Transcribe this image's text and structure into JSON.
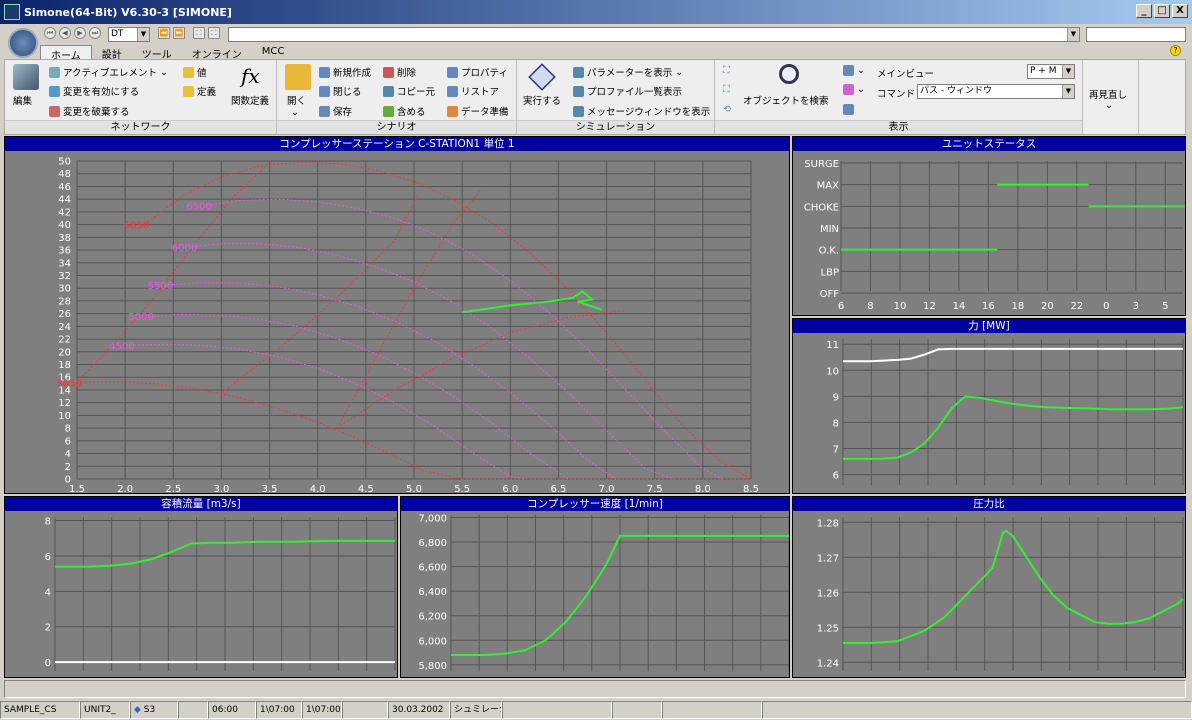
{
  "window": {
    "title": "Simone(64-Bit) V6.30-3 [SIMONE]",
    "min": "_",
    "max": "□",
    "close": "X"
  },
  "nav": {
    "mode_value": "DT"
  },
  "tabs": [
    "ホーム",
    "設計",
    "ツール",
    "オンライン",
    "MCC"
  ],
  "ribbon": {
    "network": {
      "label": "ネットワーク",
      "edit": "編集",
      "active_element": "アクティブエレメント",
      "enable_changes": "変更を有効にする",
      "discard_changes": "変更を破棄する",
      "value": "値",
      "definition": "定義",
      "fx": "fx",
      "function_def": "関数定義"
    },
    "scenario": {
      "label": "シナリオ",
      "open": "開く",
      "new": "新規作成",
      "close": "閉じる",
      "save": "保存",
      "delete": "削除",
      "copy_from": "コピー元",
      "include": "含める",
      "properties": "プロパティ",
      "restore": "リストア",
      "data_prep": "データ準備"
    },
    "simulation": {
      "label": "シミュレーション",
      "run": "実行する",
      "show_params": "パラメーターを表示",
      "profile_list": "プロファイル一覧表示",
      "message_window": "メッセージウィンドウを表示"
    },
    "display": {
      "label": "表示",
      "search_object": "オブジェクトを検索",
      "main_view_label": "メインビュー",
      "main_view_value": "P + M",
      "command_label": "コマンド",
      "command_value": "パス - ウィンドウ"
    },
    "review": {
      "label": "再見直し"
    }
  },
  "panels": {
    "map": "コンプレッサーステーション C-STATION1 単位 1",
    "status": "ユニットステータス",
    "power": "力 [MW]",
    "flow": "容積流量 [m3/s]",
    "speed": "コンプレッサー速度 [1/min]",
    "ratio": "圧力比"
  },
  "chart_data": [
    {
      "type": "line",
      "title": "コンプレッサーステーション C-STATION1 単位 1",
      "xlim": [
        1.5,
        8.5
      ],
      "ylim": [
        0,
        50
      ],
      "x_ticks": [
        "1.5",
        "2.0",
        "2.5",
        "3.0",
        "3.5",
        "4.0",
        "4.5",
        "5.0",
        "5.5",
        "6.0",
        "6.5",
        "7.0",
        "7.5",
        "8.0",
        "8.5"
      ],
      "y_ticks": [
        "0",
        "2",
        "4",
        "6",
        "8",
        "10",
        "12",
        "14",
        "16",
        "18",
        "20",
        "22",
        "24",
        "26",
        "28",
        "30",
        "32",
        "34",
        "36",
        "38",
        "40",
        "42",
        "44",
        "46",
        "48",
        "50"
      ],
      "speed_labels": [
        "6850",
        "6500",
        "6000",
        "5500",
        "5000",
        "4500",
        "3850"
      ],
      "speed_lines": [
        {
          "name": "6850",
          "x": [
            2.2,
            2.6,
            3.0,
            3.4,
            3.8,
            4.2,
            4.6,
            5.0,
            5.4,
            5.8,
            6.2,
            6.6,
            7.0,
            7.4,
            7.8,
            8.2,
            8.5
          ],
          "y": [
            40,
            44.5,
            47.5,
            49.2,
            49.8,
            49.6,
            48.6,
            46.8,
            44.0,
            40.4,
            35.6,
            29.8,
            23.0,
            15.6,
            8.2,
            2.6,
            0
          ],
          "color": "#ff3030"
        },
        {
          "name": "6500",
          "x": [
            2.85,
            3.2,
            3.6,
            4.0,
            4.4,
            4.8,
            5.2,
            5.6,
            6.0,
            6.4,
            6.8,
            7.2,
            7.6,
            8.0,
            8.2
          ],
          "y": [
            43,
            43.8,
            44,
            43.6,
            42.6,
            41.0,
            38.6,
            35.4,
            31.2,
            26.2,
            20.4,
            14,
            7.6,
            1.6,
            0
          ],
          "color": "#ee55ee"
        },
        {
          "name": "6000",
          "x": [
            2.7,
            3.0,
            3.4,
            3.8,
            4.2,
            4.6,
            5.0,
            5.4,
            5.8,
            6.2,
            6.6,
            7.0,
            7.4,
            7.7
          ],
          "y": [
            36.5,
            37.0,
            37.0,
            36.4,
            35.2,
            33.4,
            31.0,
            27.8,
            23.8,
            19.0,
            13.6,
            7.6,
            1.6,
            0
          ],
          "color": "#ee55ee"
        },
        {
          "name": "5500",
          "x": [
            2.45,
            2.8,
            3.2,
            3.6,
            4.0,
            4.4,
            4.8,
            5.2,
            5.6,
            6.0,
            6.4,
            6.8,
            7.1
          ],
          "y": [
            30.5,
            30.9,
            30.8,
            30.2,
            29.0,
            27.2,
            24.8,
            21.8,
            18.0,
            13.6,
            8.6,
            3.0,
            0
          ],
          "color": "#ee55ee"
        },
        {
          "name": "5000",
          "x": [
            2.25,
            2.6,
            3.0,
            3.4,
            3.8,
            4.2,
            4.6,
            5.0,
            5.4,
            5.8,
            6.2,
            6.6
          ],
          "y": [
            25.6,
            25.9,
            25.7,
            25.1,
            23.9,
            22.1,
            19.7,
            16.7,
            13.1,
            8.9,
            4.1,
            0
          ],
          "color": "#ee55ee"
        },
        {
          "name": "4500",
          "x": [
            2.05,
            2.4,
            2.8,
            3.2,
            3.6,
            4.0,
            4.4,
            4.8,
            5.2,
            5.6,
            6.0,
            6.15
          ],
          "y": [
            21.0,
            21.2,
            21.0,
            20.4,
            19.2,
            17.4,
            15.0,
            12.0,
            8.4,
            4.2,
            0.4,
            0
          ],
          "color": "#ee55ee"
        },
        {
          "name": "3850",
          "x": [
            1.5,
            1.9,
            2.3,
            2.7,
            3.1,
            3.5,
            3.9,
            4.3,
            4.7,
            5.1,
            5.5
          ],
          "y": [
            15.2,
            15.3,
            15.0,
            14.3,
            13.1,
            11.5,
            9.5,
            7.1,
            4.3,
            1.3,
            0
          ],
          "color": "#ff3030"
        }
      ],
      "limit_lines": [
        {
          "name": "surge",
          "x": [
            1.5,
            1.9,
            2.3,
            2.7,
            3.1,
            3.5
          ],
          "y": [
            15.2,
            21.5,
            28.5,
            36.5,
            44.0,
            49.8
          ],
          "color": "#ff3030"
        },
        {
          "name": "diagonal-a",
          "x": [
            3.0,
            3.6,
            4.2,
            4.8,
            5.05
          ],
          "y": [
            13.5,
            20.5,
            28.5,
            37.5,
            45.0
          ],
          "color": "#ff3030"
        },
        {
          "name": "diagonal-b",
          "x": [
            4.2,
            4.8,
            5.4,
            6.0,
            6.6,
            7.2
          ],
          "y": [
            8,
            14,
            19,
            23,
            25.4,
            26.5
          ],
          "color": "#ff3030"
        },
        {
          "name": "diagonal-c",
          "x": [
            4.2,
            4.6,
            5.0,
            5.4,
            5.7
          ],
          "y": [
            8,
            19,
            30,
            40,
            45.5
          ],
          "color": "#ff3030"
        },
        {
          "name": "baseline",
          "x": [
            5.5,
            8.5
          ],
          "y": [
            0,
            0
          ],
          "color": "#ff3030"
        }
      ],
      "operating_path": {
        "color": "#33ee33",
        "x": [
          5.5,
          6.0,
          6.4,
          6.65,
          6.75,
          6.85,
          6.7,
          6.95
        ],
        "y": [
          26.2,
          27.3,
          27.9,
          28.5,
          29.5,
          28.2,
          27.9,
          26.6
        ]
      }
    },
    {
      "type": "line",
      "title": "ユニットステータス",
      "y_categories": [
        "SURGE",
        "MAX",
        "CHOKE",
        "MIN",
        "O.K.",
        "LBP",
        "OFF"
      ],
      "x_ticks": [
        "6",
        "8",
        "10",
        "12",
        "14",
        "16",
        "18",
        "20",
        "22",
        "0",
        "3",
        "5"
      ],
      "segments": [
        {
          "state": "O.K.",
          "from": 6,
          "to": 16.6
        },
        {
          "state": "MAX",
          "from": 16.6,
          "to": 22.8
        },
        {
          "state": "CHOKE",
          "from": 22.8,
          "to": 30.2
        },
        {
          "state": "MAX",
          "from": 30.2,
          "to": 31
        }
      ],
      "color": "#33ee33"
    },
    {
      "type": "line",
      "title": "力 [MW]",
      "y_ticks": [
        "6",
        "7",
        "8",
        "9",
        "10",
        "11"
      ],
      "ylim": [
        5.6,
        11.2
      ],
      "series": [
        {
          "color": "#ffffff",
          "x": [
            0,
            8,
            16,
            20,
            24,
            28,
            32,
            36,
            40,
            44,
            48,
            52,
            56,
            60,
            64,
            68,
            72,
            76,
            80,
            84,
            88,
            92,
            96,
            100
          ],
          "y": [
            10.35,
            10.35,
            10.4,
            10.45,
            10.6,
            10.8,
            10.82,
            10.82,
            10.82,
            10.82,
            10.82,
            10.82,
            10.82,
            10.82,
            10.82,
            10.82,
            10.82,
            10.82,
            10.82,
            10.82,
            10.82,
            10.82,
            10.82,
            10.82
          ]
        },
        {
          "color": "#33ee33",
          "x": [
            0,
            10,
            16,
            20,
            24,
            28,
            32,
            36,
            40,
            44,
            48,
            52,
            56,
            60,
            64,
            68,
            72,
            76,
            80,
            84,
            88,
            92,
            96,
            100
          ],
          "y": [
            6.6,
            6.6,
            6.65,
            6.85,
            7.2,
            7.8,
            8.55,
            9.0,
            8.95,
            8.85,
            8.75,
            8.68,
            8.62,
            8.58,
            8.56,
            8.55,
            8.54,
            8.52,
            8.5,
            8.5,
            8.5,
            8.51,
            8.53,
            8.58
          ]
        }
      ]
    },
    {
      "type": "line",
      "title": "容積流量 [m3/s]",
      "y_ticks": [
        "0",
        "2",
        "4",
        "6",
        "8"
      ],
      "ylim": [
        -0.5,
        8.2
      ],
      "series": [
        {
          "color": "#33ee33",
          "x": [
            0,
            10,
            16,
            22,
            28,
            34,
            40,
            46,
            52,
            60,
            70,
            80,
            90,
            100
          ],
          "y": [
            5.4,
            5.4,
            5.45,
            5.55,
            5.8,
            6.2,
            6.7,
            6.75,
            6.75,
            6.8,
            6.8,
            6.85,
            6.85,
            6.85
          ]
        },
        {
          "color": "#ffffff",
          "x": [
            0,
            100
          ],
          "y": [
            0,
            0
          ]
        }
      ]
    },
    {
      "type": "line",
      "title": "コンプレッサー速度 [1/min]",
      "y_ticks": [
        "5,800",
        "6,000",
        "6,200",
        "6,400",
        "6,600",
        "6,800",
        "7,000"
      ],
      "ylim": [
        5750,
        7020
      ],
      "series": [
        {
          "color": "#33ee33",
          "x": [
            0,
            10,
            16,
            22,
            28,
            34,
            40,
            46,
            50,
            54,
            60,
            70,
            80,
            90,
            100
          ],
          "y": [
            5880,
            5880,
            5890,
            5920,
            6000,
            6150,
            6360,
            6620,
            6850,
            6850,
            6850,
            6850,
            6850,
            6850,
            6850
          ]
        }
      ]
    },
    {
      "type": "line",
      "title": "圧力比",
      "y_ticks": [
        "1.24",
        "1.25",
        "1.26",
        "1.27",
        "1.28"
      ],
      "ylim": [
        1.2375,
        1.2815
      ],
      "series": [
        {
          "color": "#33ee33",
          "x": [
            0,
            8,
            16,
            24,
            30,
            36,
            40,
            44,
            47,
            48,
            50,
            54,
            58,
            62,
            66,
            70,
            74,
            78,
            82,
            86,
            90,
            94,
            98,
            100
          ],
          "y": [
            1.2455,
            1.2455,
            1.246,
            1.249,
            1.253,
            1.259,
            1.263,
            1.267,
            1.277,
            1.2775,
            1.276,
            1.27,
            1.264,
            1.259,
            1.2555,
            1.2535,
            1.2515,
            1.251,
            1.251,
            1.2515,
            1.2525,
            1.2545,
            1.2565,
            1.258
          ]
        }
      ]
    }
  ],
  "statusbar": [
    "SAMPLE_CS",
    "UNIT2_",
    "S3",
    "",
    "06:00",
    "1\\07:00",
    "1\\07:00|",
    "",
    "30.03.2002",
    "シュミレーシ",
    "",
    "",
    "",
    ""
  ]
}
